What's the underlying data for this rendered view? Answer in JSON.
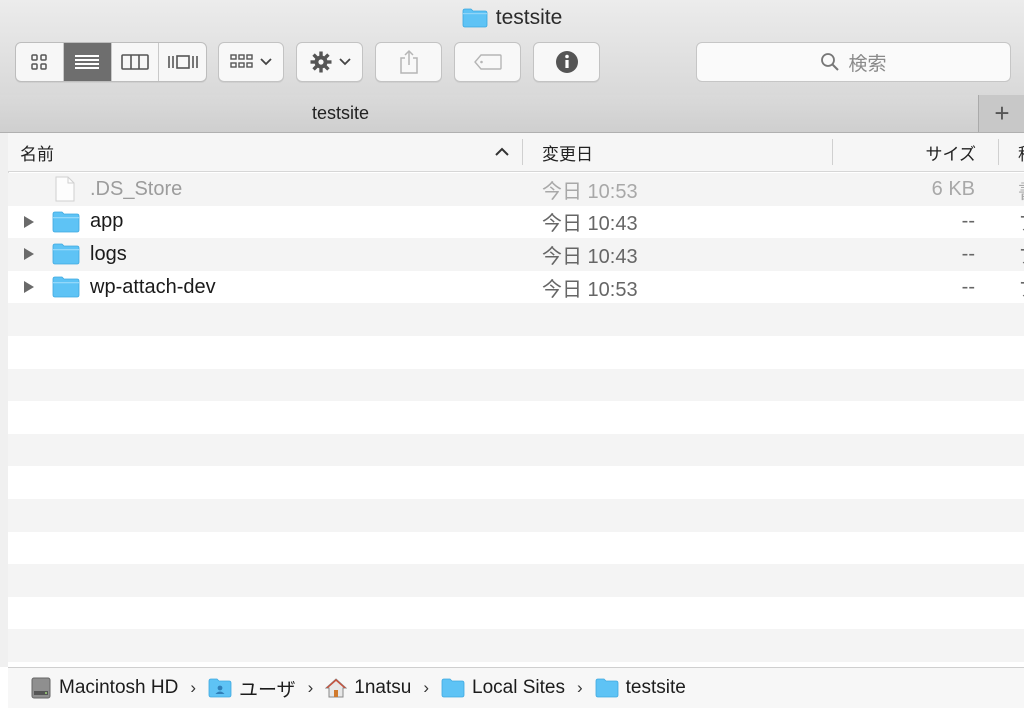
{
  "window": {
    "title": "testsite"
  },
  "search": {
    "placeholder": "検索"
  },
  "tabs": [
    {
      "label": "testsite"
    }
  ],
  "columns": {
    "name": "名前",
    "modified": "変更日",
    "size": "サイズ",
    "kind": "種"
  },
  "files": [
    {
      "name": ".DS_Store",
      "modified": "今日 10:53",
      "size": "6 KB",
      "kind": "書",
      "type": "file",
      "dimmed": true
    },
    {
      "name": "app",
      "modified": "今日 10:43",
      "size": "--",
      "kind": "フ",
      "type": "folder"
    },
    {
      "name": "logs",
      "modified": "今日 10:43",
      "size": "--",
      "kind": "フ",
      "type": "folder"
    },
    {
      "name": "wp-attach-dev",
      "modified": "今日 10:53",
      "size": "--",
      "kind": "フ",
      "type": "folder"
    }
  ],
  "path": [
    {
      "label": "Macintosh HD",
      "icon": "hard-drive-icon"
    },
    {
      "label": "ユーザ",
      "icon": "users-folder-icon"
    },
    {
      "label": "1natsu",
      "icon": "home-icon"
    },
    {
      "label": "Local Sites",
      "icon": "folder-icon"
    },
    {
      "label": "testsite",
      "icon": "folder-icon"
    }
  ],
  "colors": {
    "folder": "#5ec3f5",
    "toolbar": "#e2e2e2",
    "selected_view": "#6e6e6e"
  }
}
